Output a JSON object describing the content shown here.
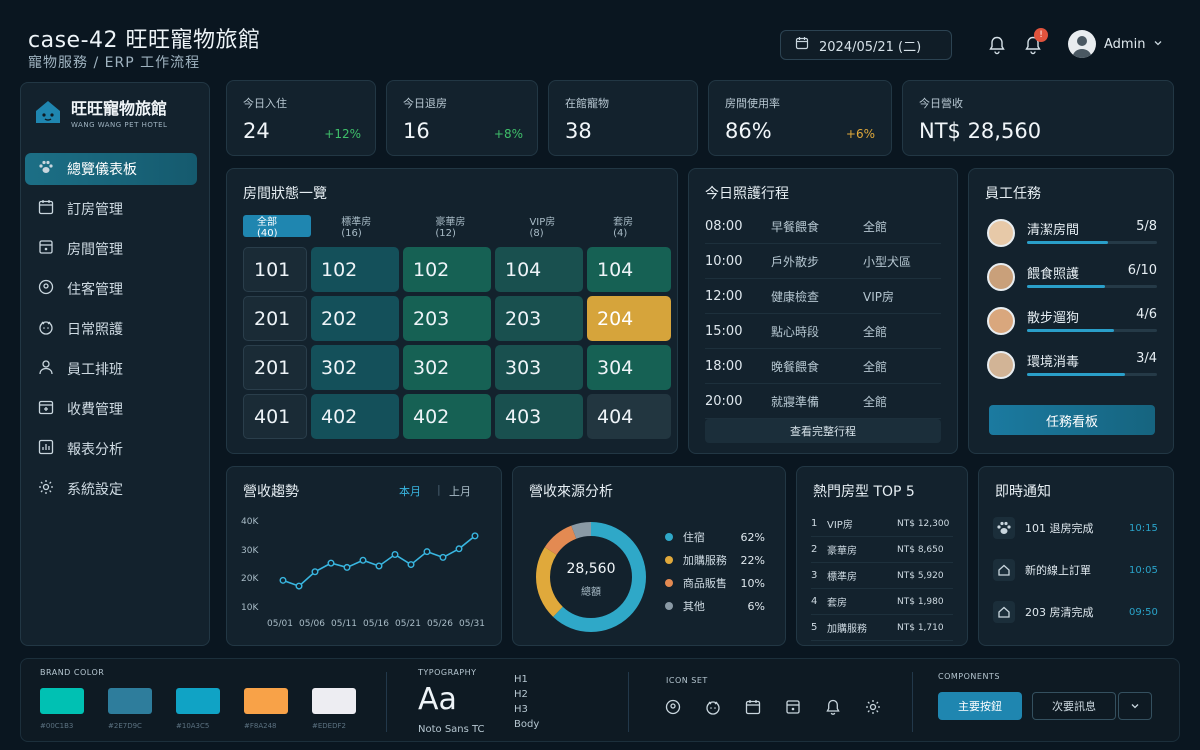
{
  "header": {
    "title": "case-42 旺旺寵物旅館",
    "subtitle": "寵物服務 / ERP 工作流程",
    "date": "2024/05/21 (二)",
    "notification_badge": "!",
    "user_name": "Admin"
  },
  "sidebar": {
    "logo_name": "旺旺寵物旅館",
    "logo_en": "WANG WANG PET HOTEL",
    "items": [
      {
        "label": "總覽儀表板",
        "icon": "paw-icon",
        "active": true
      },
      {
        "label": "訂房管理",
        "icon": "calendar-icon"
      },
      {
        "label": "房間管理",
        "icon": "room-icon"
      },
      {
        "label": "住客管理",
        "icon": "guest-icon"
      },
      {
        "label": "日常照護",
        "icon": "care-icon"
      },
      {
        "label": "員工排班",
        "icon": "staff-icon"
      },
      {
        "label": "收費管理",
        "icon": "billing-icon"
      },
      {
        "label": "報表分析",
        "icon": "report-icon"
      },
      {
        "label": "系統設定",
        "icon": "gear-icon"
      }
    ]
  },
  "stats": [
    {
      "label": "今日入住",
      "value": "24",
      "change": "+12%",
      "change_color": "#3fbf6a"
    },
    {
      "label": "今日退房",
      "value": "16",
      "change": "+8%",
      "change_color": "#3fbf6a"
    },
    {
      "label": "在館寵物",
      "value": "38",
      "change": "",
      "change_color": "#3fbf6a"
    },
    {
      "label": "房間使用率",
      "value": "86%",
      "change": "+6%",
      "change_color": "#e0a93b"
    },
    {
      "label": "今日營收",
      "value": "NT$ 28,560",
      "change": "",
      "change_color": "#3fbf6a"
    }
  ],
  "rooms": {
    "title": "房間狀態一覽",
    "tabs": [
      "全部(40)",
      "標準房(16)",
      "豪華房(12)",
      "VIP房(8)",
      "套房(4)"
    ],
    "grid": [
      [
        {
          "n": "101",
          "s": 0
        },
        {
          "n": "102",
          "s": 1
        },
        {
          "n": "102",
          "s": 2
        },
        {
          "n": "104",
          "s": 3
        },
        {
          "n": "104",
          "s": 2
        }
      ],
      [
        {
          "n": "201",
          "s": 0
        },
        {
          "n": "202",
          "s": 1
        },
        {
          "n": "203",
          "s": 2
        },
        {
          "n": "203",
          "s": 3
        },
        {
          "n": "204",
          "s": 4
        }
      ],
      [
        {
          "n": "201",
          "s": 0
        },
        {
          "n": "302",
          "s": 1
        },
        {
          "n": "302",
          "s": 2
        },
        {
          "n": "303",
          "s": 3
        },
        {
          "n": "304",
          "s": 2
        }
      ],
      [
        {
          "n": "401",
          "s": 0
        },
        {
          "n": "402",
          "s": 1
        },
        {
          "n": "402",
          "s": 2
        },
        {
          "n": "403",
          "s": 3
        },
        {
          "n": "404",
          "s": 5
        }
      ]
    ]
  },
  "schedule": {
    "title": "今日照護行程",
    "rows": [
      {
        "time": "08:00",
        "activity": "早餐餵食",
        "area": "全館"
      },
      {
        "time": "10:00",
        "activity": "戶外散步",
        "area": "小型犬區"
      },
      {
        "time": "12:00",
        "activity": "健康檢查",
        "area": "VIP房"
      },
      {
        "time": "15:00",
        "activity": "點心時段",
        "area": "全館"
      },
      {
        "time": "18:00",
        "activity": "晚餐餵食",
        "area": "全館"
      },
      {
        "time": "20:00",
        "activity": "就寢準備",
        "area": "全館"
      }
    ],
    "button": "查看完整行程"
  },
  "tasks": {
    "title": "員工任務",
    "items": [
      {
        "name": "清潔房間",
        "count": "5/8",
        "progress": 0.625
      },
      {
        "name": "餵食照護",
        "count": "6/10",
        "progress": 0.6
      },
      {
        "name": "散步遛狗",
        "count": "4/6",
        "progress": 0.667
      },
      {
        "name": "環境消毒",
        "count": "3/4",
        "progress": 0.75
      }
    ],
    "button": "任務看板"
  },
  "trend": {
    "title": "營收趨勢",
    "toggle_active": "本月",
    "toggle_other": "上月",
    "accent": "#39b6e0"
  },
  "source": {
    "title": "營收來源分析",
    "center_value": "28,560",
    "center_label": "總額",
    "items": [
      {
        "name": "住宿",
        "pct": "62%",
        "value": 62,
        "color": "#2fa8c8"
      },
      {
        "name": "加購服務",
        "pct": "22%",
        "value": 22,
        "color": "#e0a93b"
      },
      {
        "name": "商品販售",
        "pct": "10%",
        "value": 10,
        "color": "#e38a52"
      },
      {
        "name": "其他",
        "pct": "6%",
        "value": 6,
        "color": "#8a9aa5"
      }
    ]
  },
  "top5": {
    "title": "熱門房型 TOP 5",
    "rows": [
      {
        "rank": "1",
        "name": "VIP房",
        "rev": "NT$ 12,300"
      },
      {
        "rank": "2",
        "name": "豪華房",
        "rev": "NT$ 8,650"
      },
      {
        "rank": "3",
        "name": "標準房",
        "rev": "NT$ 5,920"
      },
      {
        "rank": "4",
        "name": "套房",
        "rev": "NT$ 1,980"
      },
      {
        "rank": "5",
        "name": "加購服務",
        "rev": "NT$ 1,710"
      }
    ]
  },
  "notifications": {
    "title": "即時通知",
    "items": [
      {
        "text": "101 退房完成",
        "time": "10:15",
        "icon": "paw-icon"
      },
      {
        "text": "新的線上訂單",
        "time": "10:05",
        "icon": "home-icon"
      },
      {
        "text": "203 房清完成",
        "time": "09:50",
        "icon": "home-icon"
      }
    ]
  },
  "chart_data": {
    "type": "line",
    "x": [
      "05/01",
      "05/06",
      "05/11",
      "05/16",
      "05/21",
      "05/26",
      "05/31"
    ],
    "xlabel": "",
    "ylabel": "",
    "yticks": [
      "40K",
      "30K",
      "20K",
      "10K"
    ],
    "ylim": [
      10000,
      40000
    ],
    "grid": false,
    "series": [
      {
        "values": [
          20000,
          18000,
          23000,
          26000,
          24500,
          27000,
          25000,
          29000,
          25500,
          30000,
          28000,
          31000,
          35500
        ]
      }
    ]
  },
  "guide": {
    "brand_color_label": "BRAND COLOR",
    "colors": [
      {
        "hex": "#00C1B3",
        "label": "#00C1B3"
      },
      {
        "hex": "#2E7D9C",
        "label": "#2E7D9C"
      },
      {
        "hex": "#10A3C5",
        "label": "#10A3C5"
      },
      {
        "hex": "#F8A248",
        "label": "#F8A248"
      },
      {
        "hex": "#EDEDF2",
        "label": "#EDEDF2"
      }
    ],
    "typography_label": "TYPOGRAPHY",
    "type_sample": "Aa",
    "type_font": "Noto Sans TC",
    "type_levels": [
      "H1",
      "H2",
      "H3",
      "Body"
    ],
    "icon_set_label": "ICON SET",
    "icons": [
      "guest-icon",
      "care-icon",
      "calendar-icon",
      "room-icon",
      "bell-icon",
      "gear-icon"
    ],
    "components_label": "COMPONENTS",
    "primary_button": "主要按鈕",
    "secondary_button": "次要訊息"
  }
}
